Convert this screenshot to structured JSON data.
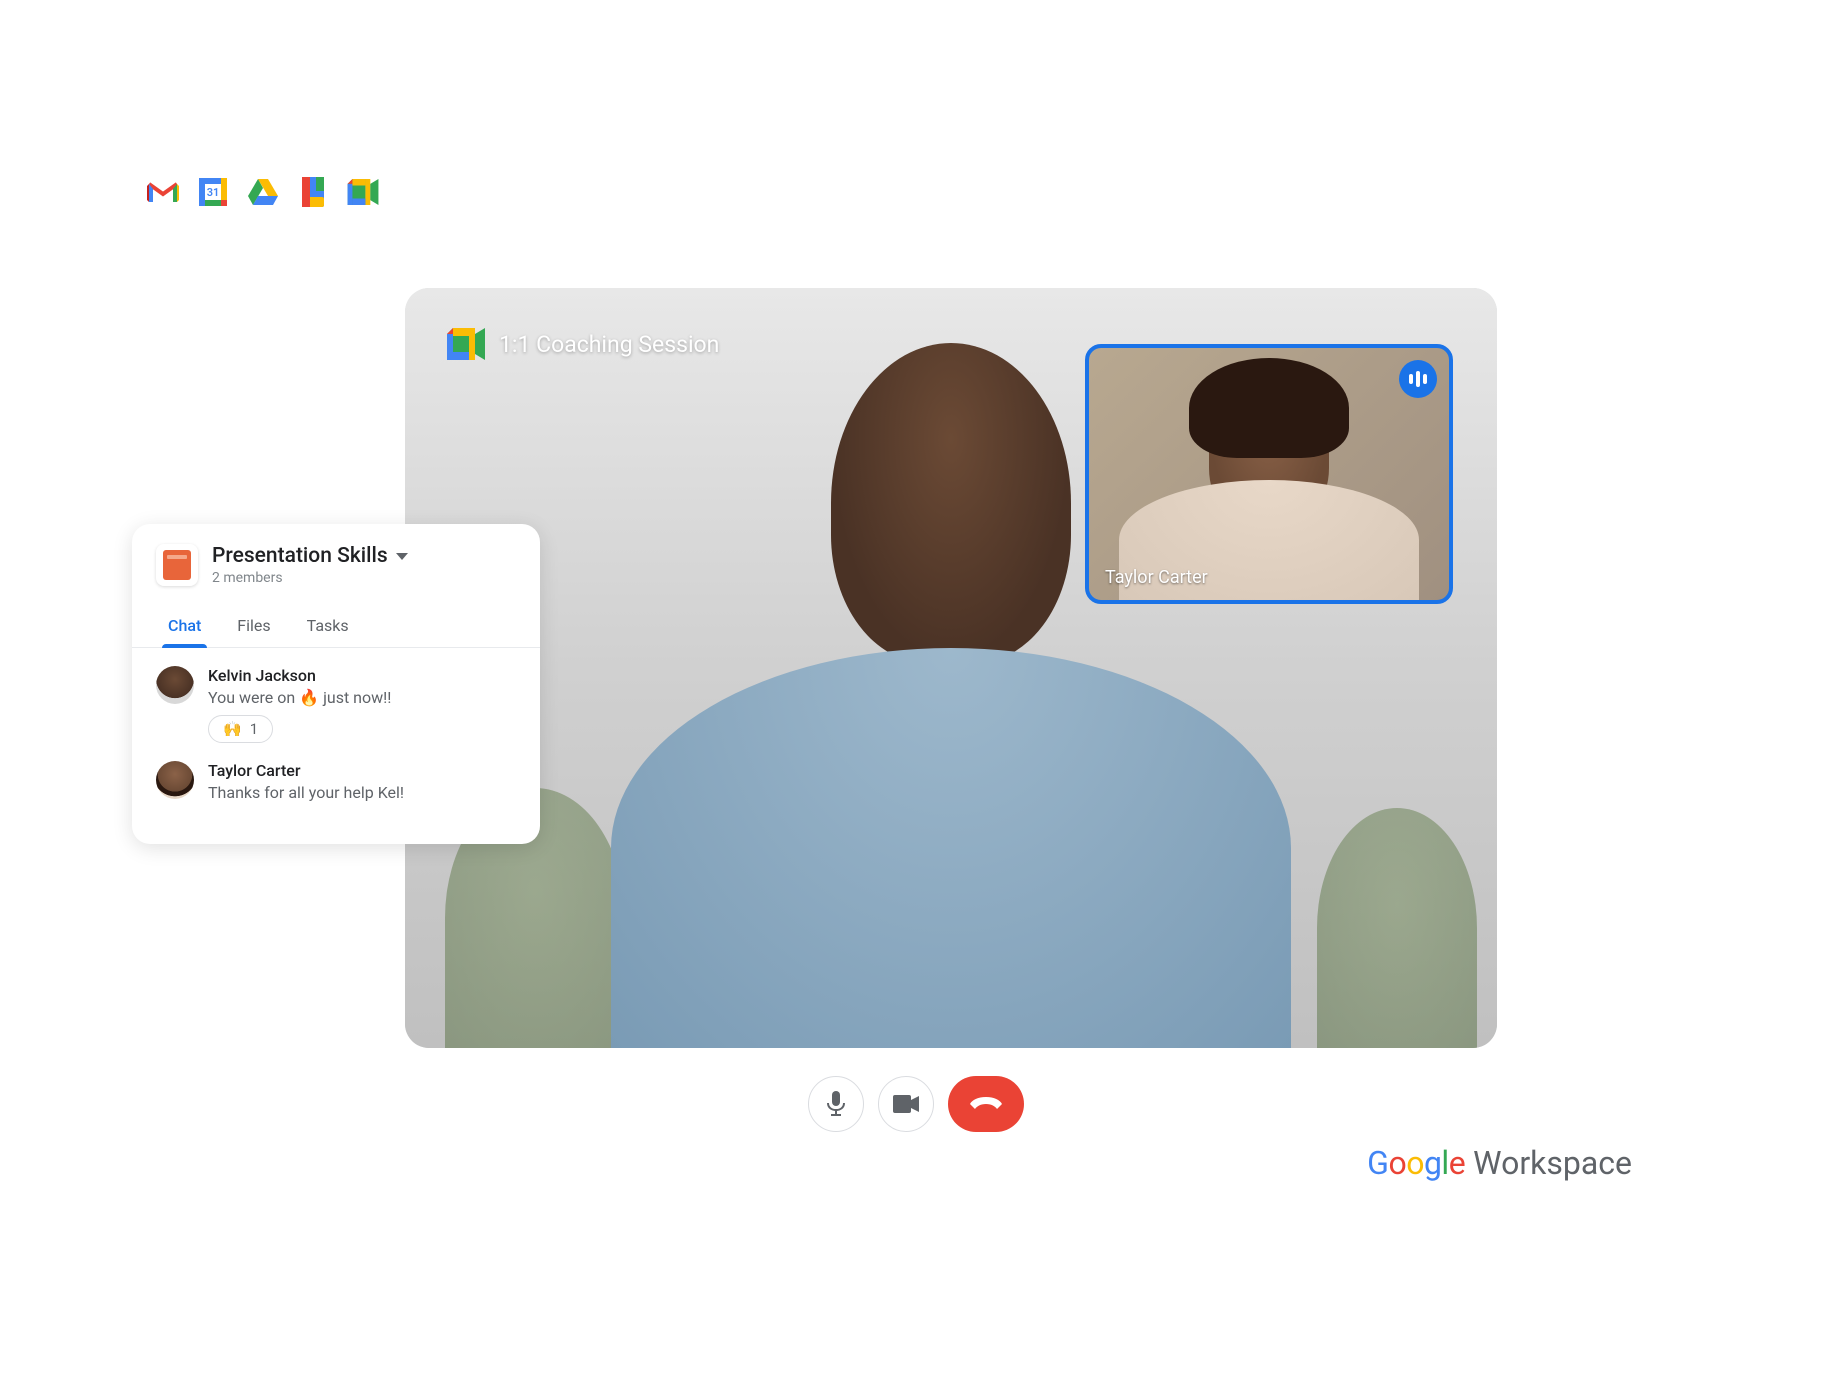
{
  "app_icons": [
    "gmail",
    "calendar",
    "drive",
    "docs",
    "meet"
  ],
  "calendar_day": "31",
  "meeting": {
    "title": "1:1 Coaching Session"
  },
  "pip": {
    "name": "Taylor Carter"
  },
  "chat": {
    "space_title": "Presentation Skills",
    "subtitle": "2 members",
    "tabs": {
      "chat": "Chat",
      "files": "Files",
      "tasks": "Tasks"
    },
    "messages": [
      {
        "sender": "Kelvin Jackson",
        "text": "You were on 🔥 just now!!",
        "reaction_emoji": "🙌",
        "reaction_count": "1"
      },
      {
        "sender": "Taylor Carter",
        "text": "Thanks for all your help Kel!"
      }
    ]
  },
  "brand": {
    "workspace": "Workspace"
  }
}
